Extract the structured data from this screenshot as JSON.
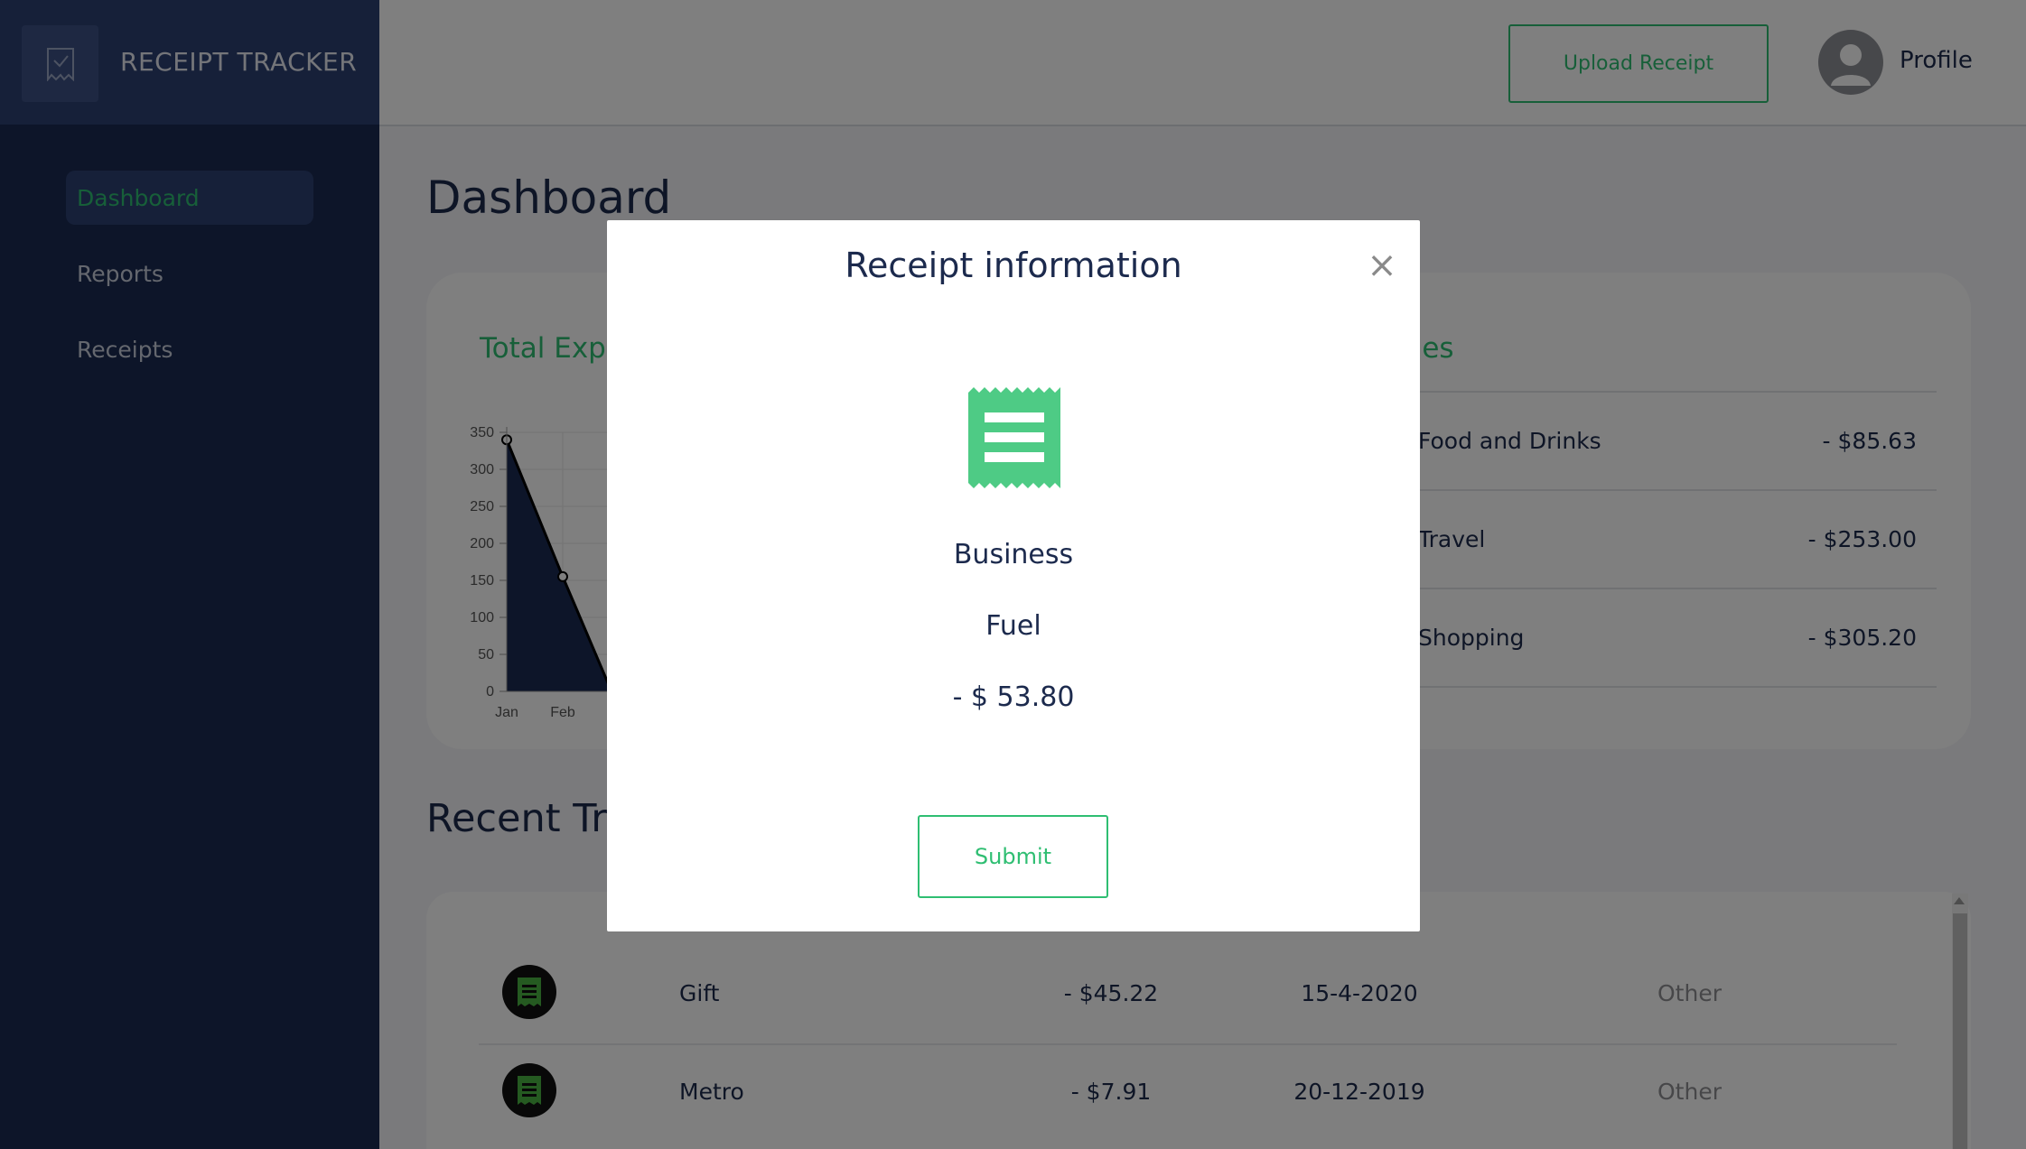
{
  "app": {
    "brand": "RECEIPT TRACKER"
  },
  "sidebar": {
    "items": [
      {
        "label": "Dashboard",
        "active": true
      },
      {
        "label": "Reports"
      },
      {
        "label": "Receipts"
      }
    ]
  },
  "topbar": {
    "upload_label": "Upload Receipt",
    "profile_label": "Profile"
  },
  "main": {
    "title": "Dashboard",
    "expenses_title": "Total Exp",
    "categories_title": "ories",
    "section_title": "Recent Tra"
  },
  "categories": [
    {
      "name": "Food and Drinks",
      "value": "- $85.63"
    },
    {
      "name": "Travel",
      "value": "- $253.00"
    },
    {
      "name": "Shopping",
      "value": "- $305.20"
    }
  ],
  "transactions": [
    {
      "name": "Gift",
      "amount": "- $45.22",
      "date": "15-4-2020",
      "category": "Other"
    },
    {
      "name": "Metro",
      "amount": "- $7.91",
      "date": "20-12-2019",
      "category": "Other"
    }
  ],
  "chart_data": {
    "type": "area",
    "categories": [
      "Jan",
      "Feb"
    ],
    "values": [
      340,
      155
    ],
    "ylim": [
      0,
      350
    ],
    "yticks": [
      0,
      50,
      100,
      150,
      200,
      250,
      300,
      350
    ],
    "color": "#1b2b52"
  },
  "modal": {
    "title": "Receipt information",
    "close_glyph": "×",
    "type": "Business",
    "category": "Fuel",
    "amount": "- $ 53.80",
    "submit_label": "Submit"
  },
  "colors": {
    "accent": "#2fbe72",
    "sidebar": "#1b2b52",
    "text": "#1c2a4d"
  }
}
